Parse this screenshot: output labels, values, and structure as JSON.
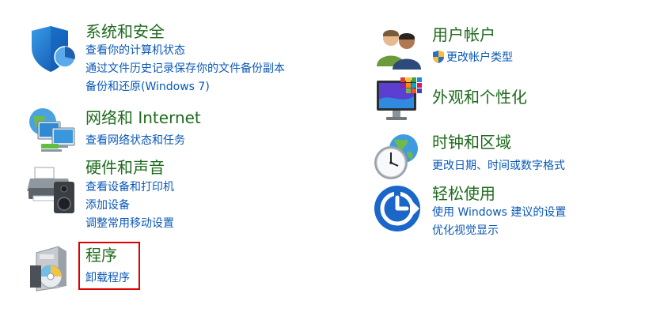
{
  "left_column": {
    "system_security": {
      "title": "系统和安全",
      "links": [
        "查看你的计算机状态",
        "通过文件历史记录保存你的文件备份副本",
        "备份和还原(Windows 7)"
      ]
    },
    "network_internet": {
      "title": "网络和 Internet",
      "links": [
        "查看网络状态和任务"
      ]
    },
    "hardware_sound": {
      "title": "硬件和声音",
      "links": [
        "查看设备和打印机",
        "添加设备",
        "调整常用移动设置"
      ]
    },
    "programs": {
      "title": "程序",
      "links": [
        "卸载程序"
      ]
    }
  },
  "right_column": {
    "user_accounts": {
      "title": "用户帐户",
      "links": [
        "更改帐户类型"
      ]
    },
    "appearance": {
      "title": "外观和个性化",
      "links": []
    },
    "clock_region": {
      "title": "时钟和区域",
      "links": [
        "更改日期、时间或数字格式"
      ]
    },
    "ease_of_access": {
      "title": "轻松使用",
      "links": [
        "使用 Windows 建议的设置",
        "优化视觉显示"
      ]
    }
  },
  "colors": {
    "title_green": "#1e6b1e",
    "link_blue": "#0a58b8",
    "highlight_red": "#e00000"
  }
}
